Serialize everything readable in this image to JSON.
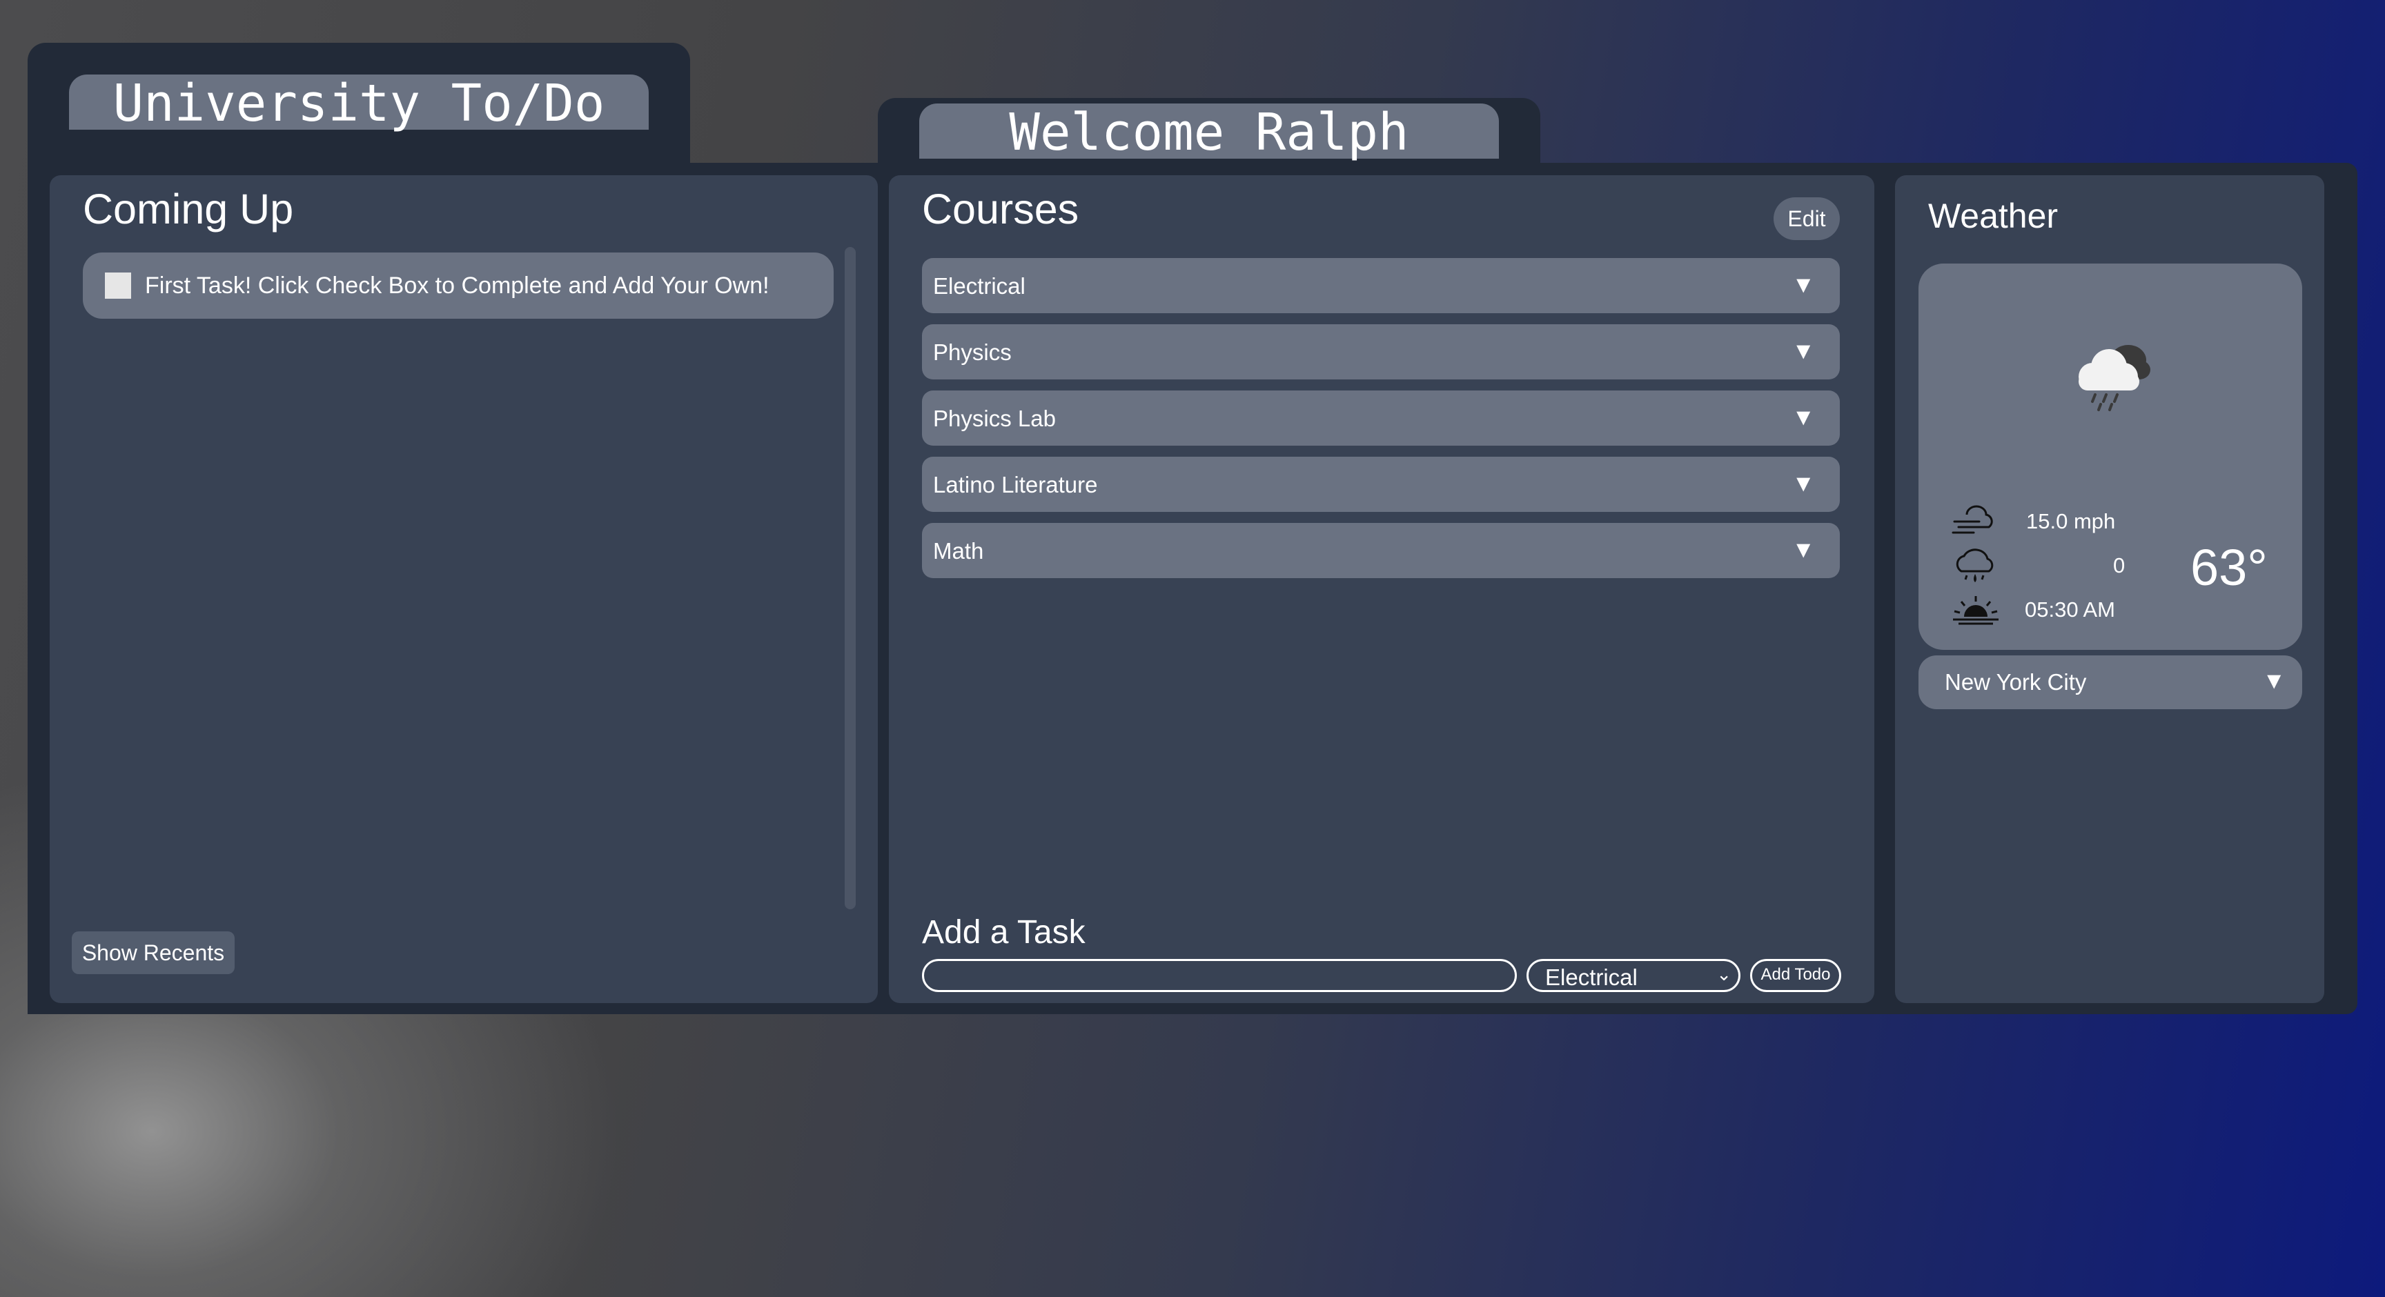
{
  "left_panel": {
    "tab_title": "University To/Do",
    "heading": "Coming Up",
    "tasks": [
      {
        "text": "First Task! Click Check Box to Complete and Add Your Own!",
        "checked": false
      }
    ],
    "show_recents_label": "Show Recents"
  },
  "center_panel": {
    "tab_title": "Welcome Ralph",
    "heading": "Courses",
    "edit_label": "Edit",
    "courses": [
      {
        "label": "Electrical"
      },
      {
        "label": "Physics"
      },
      {
        "label": "Physics Lab"
      },
      {
        "label": "Latino Literature"
      },
      {
        "label": "Math"
      }
    ],
    "add_task": {
      "heading": "Add a Task",
      "input_value": "",
      "input_placeholder": "",
      "course_select_value": "Electrical",
      "add_button_label": "Add Todo"
    }
  },
  "weather": {
    "heading": "Weather",
    "condition_icon": "cloud-rain-icon",
    "wind": "15.0 mph",
    "precipitation": "0",
    "sunrise": "05:30 AM",
    "temperature": "63°",
    "city": "New York City"
  },
  "colors": {
    "frame": "#222a38",
    "panel": "#384254",
    "pill": "#6a7282",
    "text": "#ffffff"
  }
}
